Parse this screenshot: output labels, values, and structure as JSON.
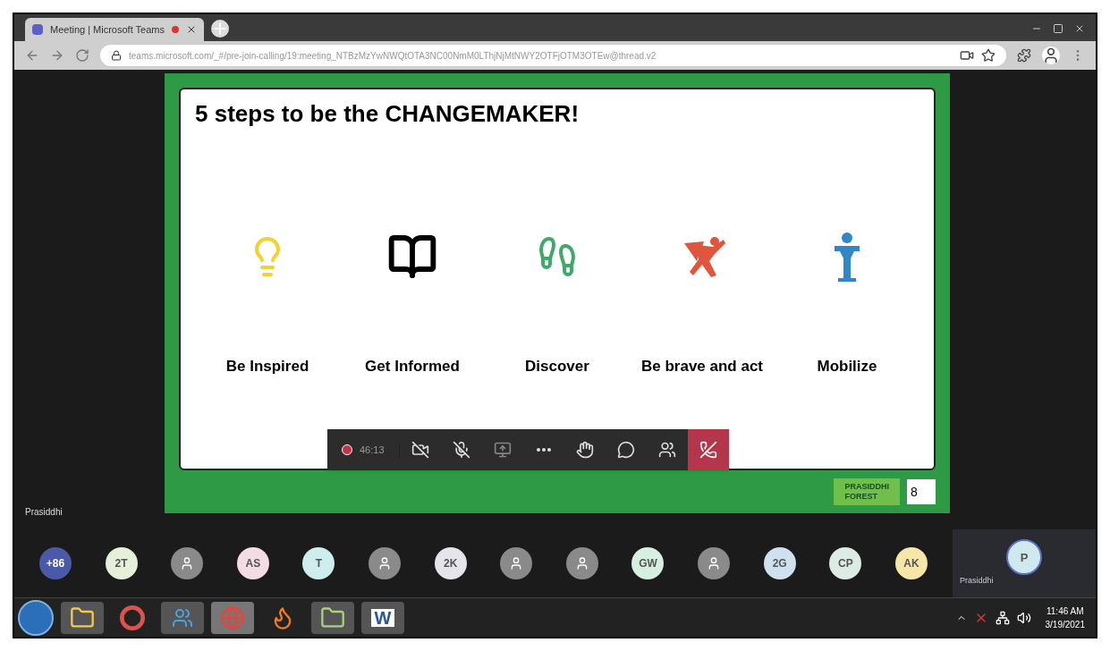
{
  "browser": {
    "tab_title": "Meeting | Microsoft Teams",
    "url": "teams.microsoft.com/_#/pre-join-calling/19:meeting_NTBzMzYwNWQtOTA3NC00NmM0LThjNjMtNWY2OTFjOTM3OTEw@thread.v2"
  },
  "slide": {
    "title": "5 steps to be the CHANGEMAKER!",
    "steps": [
      {
        "label": "Be Inspired",
        "kind": "bulb"
      },
      {
        "label": "Get Informed",
        "kind": "book"
      },
      {
        "label": "Discover",
        "kind": "feet"
      },
      {
        "label": "Be brave and act",
        "kind": "hero"
      },
      {
        "label": "Mobilize",
        "kind": "speaker"
      }
    ],
    "logo": [
      "PRASIDDHI",
      "FOREST"
    ],
    "page_number": "8"
  },
  "presenter_name": "Prasiddhi",
  "call_controls": {
    "timer": "46:13",
    "buttons": [
      {
        "kind": "camera"
      },
      {
        "kind": "mic"
      },
      {
        "kind": "share"
      },
      {
        "kind": "more"
      },
      {
        "kind": "hand"
      },
      {
        "kind": "chat"
      },
      {
        "kind": "people"
      },
      {
        "kind": "hangup"
      }
    ]
  },
  "participants": [
    {
      "kind": "overflow",
      "label": "+86",
      "color": "#4b5aa8"
    },
    {
      "kind": "initials",
      "label": "2T",
      "color": "#e6efd9"
    },
    {
      "kind": "anonymous",
      "color": "#8a8a8a"
    },
    {
      "kind": "initials",
      "label": "AS",
      "color": "#f2dde4"
    },
    {
      "kind": "initials",
      "label": "T",
      "color": "#cdeeed"
    },
    {
      "kind": "anonymous",
      "color": "#8a8a8a"
    },
    {
      "kind": "initials",
      "label": "2K",
      "color": "#e4e4ea"
    },
    {
      "kind": "anonymous",
      "color": "#8a8a8a"
    },
    {
      "kind": "anonymous",
      "color": "#8a8a8a"
    },
    {
      "kind": "initials",
      "label": "GW",
      "color": "#d6efe0"
    },
    {
      "kind": "anonymous",
      "color": "#8a8a8a"
    },
    {
      "kind": "initials",
      "label": "2G",
      "color": "#cfe0ee"
    },
    {
      "kind": "initials",
      "label": "CP",
      "color": "#dcebe3"
    },
    {
      "kind": "initials",
      "label": "AK",
      "color": "#f6e6a8"
    }
  ],
  "self_tile": {
    "initials": "P",
    "name": "Prasiddhi"
  },
  "taskbar": {
    "apps": [
      {
        "kind": "start"
      },
      {
        "kind": "folder"
      },
      {
        "kind": "picasa"
      },
      {
        "kind": "people"
      },
      {
        "kind": "chrome"
      },
      {
        "kind": "firefox"
      },
      {
        "kind": "files"
      },
      {
        "kind": "word",
        "label": "W"
      }
    ],
    "time": "11:46 AM",
    "date": "3/19/2021"
  }
}
